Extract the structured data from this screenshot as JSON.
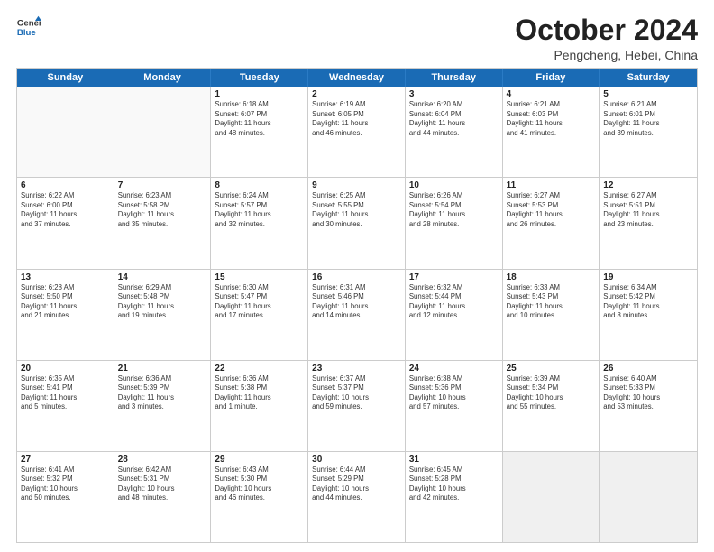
{
  "header": {
    "logo_line1": "General",
    "logo_line2": "Blue",
    "month_title": "October 2024",
    "location": "Pengcheng, Hebei, China"
  },
  "days_of_week": [
    "Sunday",
    "Monday",
    "Tuesday",
    "Wednesday",
    "Thursday",
    "Friday",
    "Saturday"
  ],
  "rows": [
    [
      {
        "day": "",
        "empty": true
      },
      {
        "day": "",
        "empty": true
      },
      {
        "day": "1",
        "lines": [
          "Sunrise: 6:18 AM",
          "Sunset: 6:07 PM",
          "Daylight: 11 hours",
          "and 48 minutes."
        ]
      },
      {
        "day": "2",
        "lines": [
          "Sunrise: 6:19 AM",
          "Sunset: 6:05 PM",
          "Daylight: 11 hours",
          "and 46 minutes."
        ]
      },
      {
        "day": "3",
        "lines": [
          "Sunrise: 6:20 AM",
          "Sunset: 6:04 PM",
          "Daylight: 11 hours",
          "and 44 minutes."
        ]
      },
      {
        "day": "4",
        "lines": [
          "Sunrise: 6:21 AM",
          "Sunset: 6:03 PM",
          "Daylight: 11 hours",
          "and 41 minutes."
        ]
      },
      {
        "day": "5",
        "lines": [
          "Sunrise: 6:21 AM",
          "Sunset: 6:01 PM",
          "Daylight: 11 hours",
          "and 39 minutes."
        ]
      }
    ],
    [
      {
        "day": "6",
        "lines": [
          "Sunrise: 6:22 AM",
          "Sunset: 6:00 PM",
          "Daylight: 11 hours",
          "and 37 minutes."
        ]
      },
      {
        "day": "7",
        "lines": [
          "Sunrise: 6:23 AM",
          "Sunset: 5:58 PM",
          "Daylight: 11 hours",
          "and 35 minutes."
        ]
      },
      {
        "day": "8",
        "lines": [
          "Sunrise: 6:24 AM",
          "Sunset: 5:57 PM",
          "Daylight: 11 hours",
          "and 32 minutes."
        ]
      },
      {
        "day": "9",
        "lines": [
          "Sunrise: 6:25 AM",
          "Sunset: 5:55 PM",
          "Daylight: 11 hours",
          "and 30 minutes."
        ]
      },
      {
        "day": "10",
        "lines": [
          "Sunrise: 6:26 AM",
          "Sunset: 5:54 PM",
          "Daylight: 11 hours",
          "and 28 minutes."
        ]
      },
      {
        "day": "11",
        "lines": [
          "Sunrise: 6:27 AM",
          "Sunset: 5:53 PM",
          "Daylight: 11 hours",
          "and 26 minutes."
        ]
      },
      {
        "day": "12",
        "lines": [
          "Sunrise: 6:27 AM",
          "Sunset: 5:51 PM",
          "Daylight: 11 hours",
          "and 23 minutes."
        ]
      }
    ],
    [
      {
        "day": "13",
        "lines": [
          "Sunrise: 6:28 AM",
          "Sunset: 5:50 PM",
          "Daylight: 11 hours",
          "and 21 minutes."
        ]
      },
      {
        "day": "14",
        "lines": [
          "Sunrise: 6:29 AM",
          "Sunset: 5:48 PM",
          "Daylight: 11 hours",
          "and 19 minutes."
        ]
      },
      {
        "day": "15",
        "lines": [
          "Sunrise: 6:30 AM",
          "Sunset: 5:47 PM",
          "Daylight: 11 hours",
          "and 17 minutes."
        ]
      },
      {
        "day": "16",
        "lines": [
          "Sunrise: 6:31 AM",
          "Sunset: 5:46 PM",
          "Daylight: 11 hours",
          "and 14 minutes."
        ]
      },
      {
        "day": "17",
        "lines": [
          "Sunrise: 6:32 AM",
          "Sunset: 5:44 PM",
          "Daylight: 11 hours",
          "and 12 minutes."
        ]
      },
      {
        "day": "18",
        "lines": [
          "Sunrise: 6:33 AM",
          "Sunset: 5:43 PM",
          "Daylight: 11 hours",
          "and 10 minutes."
        ]
      },
      {
        "day": "19",
        "lines": [
          "Sunrise: 6:34 AM",
          "Sunset: 5:42 PM",
          "Daylight: 11 hours",
          "and 8 minutes."
        ]
      }
    ],
    [
      {
        "day": "20",
        "lines": [
          "Sunrise: 6:35 AM",
          "Sunset: 5:41 PM",
          "Daylight: 11 hours",
          "and 5 minutes."
        ]
      },
      {
        "day": "21",
        "lines": [
          "Sunrise: 6:36 AM",
          "Sunset: 5:39 PM",
          "Daylight: 11 hours",
          "and 3 minutes."
        ]
      },
      {
        "day": "22",
        "lines": [
          "Sunrise: 6:36 AM",
          "Sunset: 5:38 PM",
          "Daylight: 11 hours",
          "and 1 minute."
        ]
      },
      {
        "day": "23",
        "lines": [
          "Sunrise: 6:37 AM",
          "Sunset: 5:37 PM",
          "Daylight: 10 hours",
          "and 59 minutes."
        ]
      },
      {
        "day": "24",
        "lines": [
          "Sunrise: 6:38 AM",
          "Sunset: 5:36 PM",
          "Daylight: 10 hours",
          "and 57 minutes."
        ]
      },
      {
        "day": "25",
        "lines": [
          "Sunrise: 6:39 AM",
          "Sunset: 5:34 PM",
          "Daylight: 10 hours",
          "and 55 minutes."
        ]
      },
      {
        "day": "26",
        "lines": [
          "Sunrise: 6:40 AM",
          "Sunset: 5:33 PM",
          "Daylight: 10 hours",
          "and 53 minutes."
        ]
      }
    ],
    [
      {
        "day": "27",
        "lines": [
          "Sunrise: 6:41 AM",
          "Sunset: 5:32 PM",
          "Daylight: 10 hours",
          "and 50 minutes."
        ]
      },
      {
        "day": "28",
        "lines": [
          "Sunrise: 6:42 AM",
          "Sunset: 5:31 PM",
          "Daylight: 10 hours",
          "and 48 minutes."
        ]
      },
      {
        "day": "29",
        "lines": [
          "Sunrise: 6:43 AM",
          "Sunset: 5:30 PM",
          "Daylight: 10 hours",
          "and 46 minutes."
        ]
      },
      {
        "day": "30",
        "lines": [
          "Sunrise: 6:44 AM",
          "Sunset: 5:29 PM",
          "Daylight: 10 hours",
          "and 44 minutes."
        ]
      },
      {
        "day": "31",
        "lines": [
          "Sunrise: 6:45 AM",
          "Sunset: 5:28 PM",
          "Daylight: 10 hours",
          "and 42 minutes."
        ]
      },
      {
        "day": "",
        "empty": true,
        "shaded": true
      },
      {
        "day": "",
        "empty": true,
        "shaded": true
      }
    ]
  ]
}
